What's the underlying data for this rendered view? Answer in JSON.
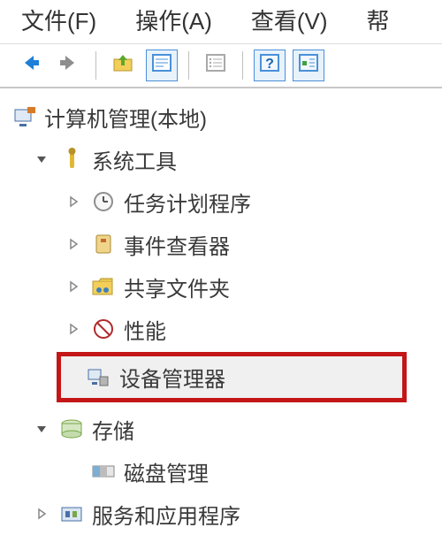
{
  "menubar": {
    "file": "文件(F)",
    "action": "操作(A)",
    "view": "查看(V)",
    "help_partial": "帮"
  },
  "tree": {
    "root": "计算机管理(本地)",
    "system_tools": "系统工具",
    "task_scheduler": "任务计划程序",
    "event_viewer": "事件查看器",
    "shared_folders": "共享文件夹",
    "performance": "性能",
    "device_manager": "设备管理器",
    "storage": "存储",
    "disk_management": "磁盘管理",
    "services_apps": "服务和应用程序"
  },
  "colors": {
    "highlight_border": "#c41616"
  }
}
